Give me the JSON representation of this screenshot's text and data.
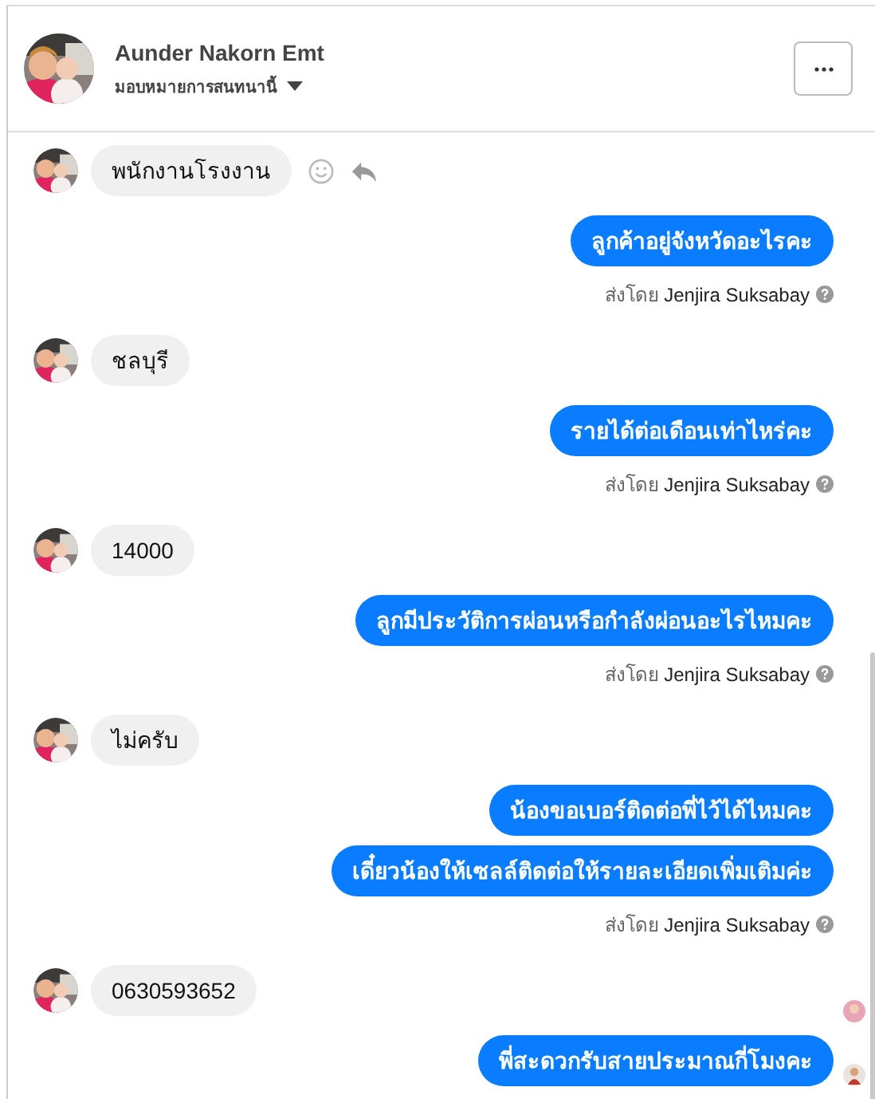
{
  "header": {
    "name": "Aunder Nakorn Emt",
    "subtitle": "มอบหมายการสนทนานี้"
  },
  "messages": [
    {
      "kind": "incoming",
      "text": "พนักงานโรงงาน",
      "actions": true,
      "receipt": false
    },
    {
      "kind": "outgoing",
      "text": "ลูกค้าอยู่จังหวัดอะไรคะ",
      "receipt": false
    },
    {
      "kind": "note",
      "prefix": "ส่งโดย",
      "sender": "Jenjira Suksabay"
    },
    {
      "kind": "incoming",
      "text": "ชลบุรี",
      "actions": false,
      "receipt": false
    },
    {
      "kind": "outgoing",
      "text": "รายได้ต่อเดือนเท่าไหร่คะ",
      "receipt": false
    },
    {
      "kind": "note",
      "prefix": "ส่งโดย",
      "sender": "Jenjira Suksabay"
    },
    {
      "kind": "incoming",
      "text": "14000",
      "actions": false,
      "receipt": false
    },
    {
      "kind": "outgoing",
      "text": "ลูกมีประวัติการผ่อนหรือกำลังผ่อนอะไรไหมคะ",
      "receipt": false
    },
    {
      "kind": "note",
      "prefix": "ส่งโดย",
      "sender": "Jenjira Suksabay"
    },
    {
      "kind": "incoming",
      "text": "ไม่ครับ",
      "actions": false,
      "receipt": false
    },
    {
      "kind": "outgoing",
      "text": "น้องขอเบอร์ติดต่อพี่ไว้ได้ไหมคะ",
      "receipt": false
    },
    {
      "kind": "outgoing",
      "text": "เดี๋ยวน้องให้เซลล์ติดต่อให้รายละเอียดเพิ่มเติมค่ะ",
      "receipt": false
    },
    {
      "kind": "note",
      "prefix": "ส่งโดย",
      "sender": "Jenjira Suksabay"
    },
    {
      "kind": "incoming",
      "text": "0630593652",
      "actions": false,
      "receipt": true
    },
    {
      "kind": "outgoing",
      "text": "พี่สะดวกรับสายประมาณกี่โมงคะ",
      "receipt": true
    }
  ]
}
